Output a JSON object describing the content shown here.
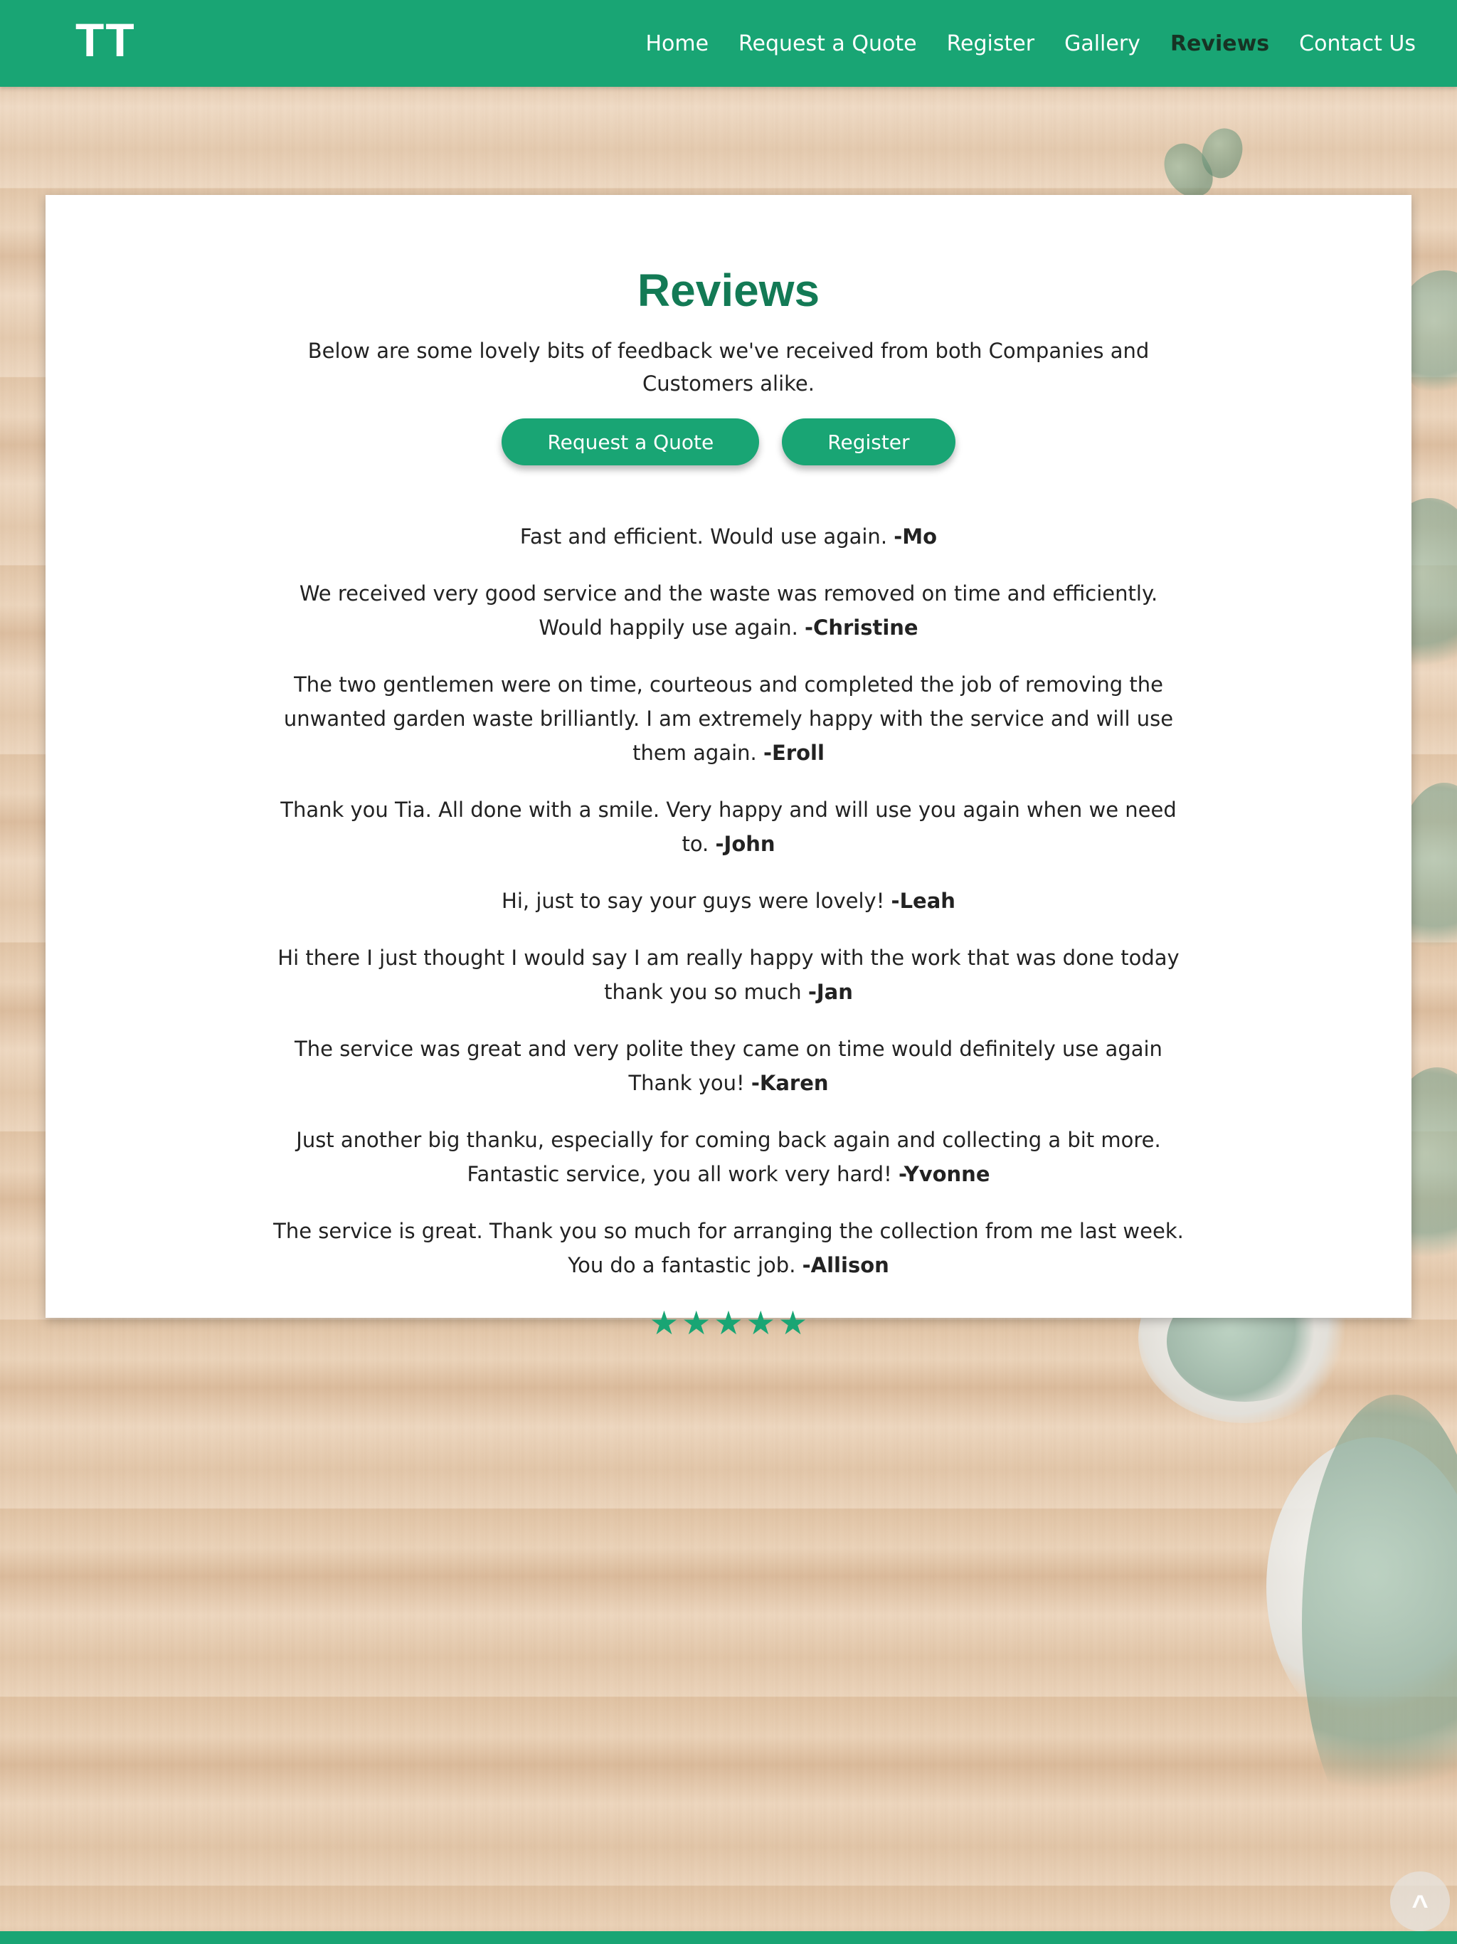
{
  "brand": {
    "logo_text": "TT"
  },
  "nav": {
    "items": [
      {
        "label": "Home",
        "active": false
      },
      {
        "label": "Request a Quote",
        "active": false
      },
      {
        "label": "Register",
        "active": false
      },
      {
        "label": "Gallery",
        "active": false
      },
      {
        "label": "Reviews",
        "active": true
      },
      {
        "label": "Contact Us",
        "active": false
      }
    ]
  },
  "main": {
    "title": "Reviews",
    "intro": "Below are some lovely bits of feedback we've received from both Companies and Customers alike.",
    "buttons": {
      "quote_label": "Request a Quote",
      "register_label": "Register"
    },
    "reviews": [
      {
        "text": "Fast and efficient. Would use again.",
        "author": "-Mo"
      },
      {
        "text": "We received very good service and the waste was removed on time and efficiently. Would happily use again.",
        "author": "-Christine"
      },
      {
        "text": "The two gentlemen were on time, courteous and completed the job of removing the unwanted garden waste brilliantly. I am extremely happy with the service and will use them again.",
        "author": "-Eroll"
      },
      {
        "text": "Thank you Tia. All done with a smile. Very happy and will use you again when we need to.",
        "author": "-John"
      },
      {
        "text": "Hi, just to say your guys were lovely!",
        "author": "-Leah"
      },
      {
        "text": "Hi there I just thought I would say I am really happy with the work that was done today thank you so much",
        "author": "-Jan"
      },
      {
        "text": "The service was great and very polite they came on time would definitely use again Thank you!",
        "author": "-Karen"
      },
      {
        "text": "Just another big thanku, especially for coming back again and collecting a bit more. Fantastic service, you all work very hard!",
        "author": "-Yvonne"
      },
      {
        "text": "The service is great. Thank you so much for arranging the collection from me last week. You do a fantastic job.",
        "author": "-Allison"
      }
    ],
    "rating": {
      "stars": 5,
      "glyph": "★"
    }
  },
  "back_to_top": {
    "label": "^"
  },
  "colors": {
    "accent": "#19a574",
    "title": "#137a55",
    "active_nav": "#173324",
    "text": "#222222"
  },
  "icons": {
    "star": "star-icon",
    "back_to_top": "chevron-up-icon"
  }
}
